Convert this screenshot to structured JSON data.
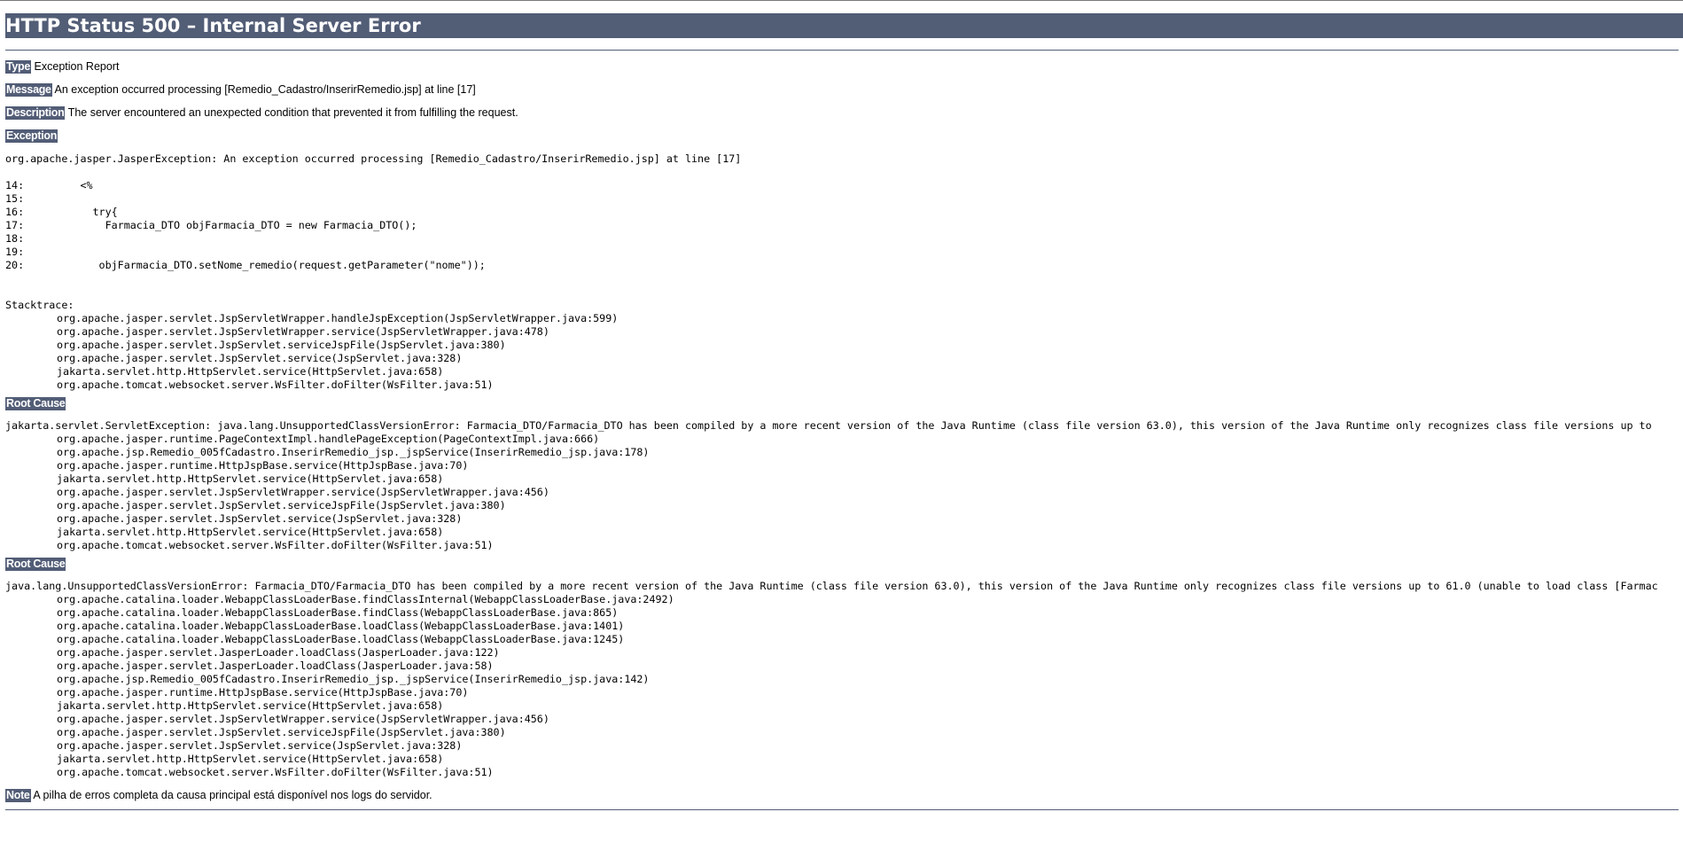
{
  "title": "HTTP Status 500 – Internal Server Error",
  "type": {
    "label": "Type",
    "value": "Exception Report"
  },
  "message": {
    "label": "Message",
    "value": "An exception occurred processing [Remedio_Cadastro/InserirRemedio.jsp] at line [17]"
  },
  "description": {
    "label": "Description",
    "value": "The server encountered an unexpected condition that prevented it from fulfilling the request."
  },
  "exception": {
    "label": "Exception",
    "headline": "org.apache.jasper.JasperException: An exception occurred processing [Remedio_Cadastro/InserirRemedio.jsp] at line [17]",
    "source_lines": [
      "14:         <%",
      "15: ",
      "16:           try{",
      "17:             Farmacia_DTO objFarmacia_DTO = new Farmacia_DTO();",
      "18: ",
      "19: ",
      "20:            objFarmacia_DTO.setNome_remedio(request.getParameter(\"nome\"));"
    ],
    "stacktrace_label": "Stacktrace:",
    "stacktrace": [
      "org.apache.jasper.servlet.JspServletWrapper.handleJspException(JspServletWrapper.java:599)",
      "org.apache.jasper.servlet.JspServletWrapper.service(JspServletWrapper.java:478)",
      "org.apache.jasper.servlet.JspServlet.serviceJspFile(JspServlet.java:380)",
      "org.apache.jasper.servlet.JspServlet.service(JspServlet.java:328)",
      "jakarta.servlet.http.HttpServlet.service(HttpServlet.java:658)",
      "org.apache.tomcat.websocket.server.WsFilter.doFilter(WsFilter.java:51)"
    ]
  },
  "root_cause_1": {
    "label": "Root Cause",
    "headline": "jakarta.servlet.ServletException: java.lang.UnsupportedClassVersionError: Farmacia_DTO/Farmacia_DTO has been compiled by a more recent version of the Java Runtime (class file version 63.0), this version of the Java Runtime only recognizes class file versions up to",
    "stacktrace": [
      "org.apache.jasper.runtime.PageContextImpl.handlePageException(PageContextImpl.java:666)",
      "org.apache.jsp.Remedio_005fCadastro.InserirRemedio_jsp._jspService(InserirRemedio_jsp.java:178)",
      "org.apache.jasper.runtime.HttpJspBase.service(HttpJspBase.java:70)",
      "jakarta.servlet.http.HttpServlet.service(HttpServlet.java:658)",
      "org.apache.jasper.servlet.JspServletWrapper.service(JspServletWrapper.java:456)",
      "org.apache.jasper.servlet.JspServlet.serviceJspFile(JspServlet.java:380)",
      "org.apache.jasper.servlet.JspServlet.service(JspServlet.java:328)",
      "jakarta.servlet.http.HttpServlet.service(HttpServlet.java:658)",
      "org.apache.tomcat.websocket.server.WsFilter.doFilter(WsFilter.java:51)"
    ]
  },
  "root_cause_2": {
    "label": "Root Cause",
    "headline": "java.lang.UnsupportedClassVersionError: Farmacia_DTO/Farmacia_DTO has been compiled by a more recent version of the Java Runtime (class file version 63.0), this version of the Java Runtime only recognizes class file versions up to 61.0 (unable to load class [Farmac",
    "stacktrace": [
      "org.apache.catalina.loader.WebappClassLoaderBase.findClassInternal(WebappClassLoaderBase.java:2492)",
      "org.apache.catalina.loader.WebappClassLoaderBase.findClass(WebappClassLoaderBase.java:865)",
      "org.apache.catalina.loader.WebappClassLoaderBase.loadClass(WebappClassLoaderBase.java:1401)",
      "org.apache.catalina.loader.WebappClassLoaderBase.loadClass(WebappClassLoaderBase.java:1245)",
      "org.apache.jasper.servlet.JasperLoader.loadClass(JasperLoader.java:122)",
      "org.apache.jasper.servlet.JasperLoader.loadClass(JasperLoader.java:58)",
      "org.apache.jsp.Remedio_005fCadastro.InserirRemedio_jsp._jspService(InserirRemedio_jsp.java:142)",
      "org.apache.jasper.runtime.HttpJspBase.service(HttpJspBase.java:70)",
      "jakarta.servlet.http.HttpServlet.service(HttpServlet.java:658)",
      "org.apache.jasper.servlet.JspServletWrapper.service(JspServletWrapper.java:456)",
      "org.apache.jasper.servlet.JspServlet.serviceJspFile(JspServlet.java:380)",
      "org.apache.jasper.servlet.JspServlet.service(JspServlet.java:328)",
      "jakarta.servlet.http.HttpServlet.service(HttpServlet.java:658)",
      "org.apache.tomcat.websocket.server.WsFilter.doFilter(WsFilter.java:51)"
    ]
  },
  "note": {
    "label": "Note",
    "value": "A pilha de erros completa da causa principal está disponível nos logs do servidor."
  },
  "colors": {
    "accent": "#525d76"
  }
}
